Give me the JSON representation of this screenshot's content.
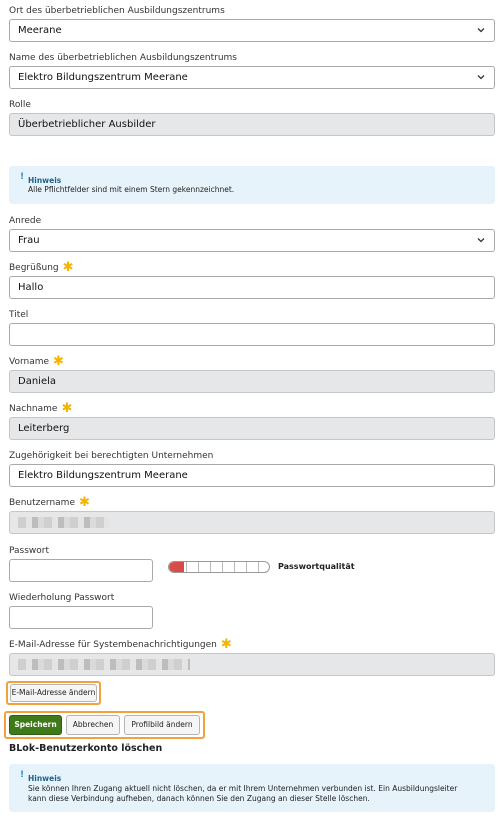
{
  "ort": {
    "label": "Ort des überbetrieblichen Ausbildungszentrums",
    "value": "Meerane"
  },
  "zentrum_name": {
    "label": "Name des überbetrieblichen Ausbildungszentrums",
    "value": "Elektro Bildungszentrum Meerane"
  },
  "rolle": {
    "label": "Rolle",
    "value": "Überbetrieblicher Ausbilder"
  },
  "hint_required": {
    "title": "Hinweis",
    "text": "Alle Pflichtfelder sind mit einem Stern gekennzeichnet.",
    "excl": "!"
  },
  "anrede": {
    "label": "Anrede",
    "value": "Frau"
  },
  "begruessung": {
    "label": "Begrüßung",
    "value": "Hallo"
  },
  "titel": {
    "label": "Titel",
    "value": ""
  },
  "vorname": {
    "label": "Vorname",
    "value": "Daniela"
  },
  "nachname": {
    "label": "Nachname",
    "value": "Leiterberg"
  },
  "zugehoerigkeit": {
    "label": "Zugehörigkeit bei berechtigten Unternehmen",
    "value": "Elektro Bildungszentrum Meerane"
  },
  "benutzername": {
    "label": "Benutzername"
  },
  "passwort": {
    "label": "Passwort",
    "quality_label": "Passwortqualität",
    "quality_fraction": 0.15
  },
  "passwort_wdh": {
    "label": "Wiederholung Passwort"
  },
  "email": {
    "label": "E-Mail-Adresse für Systembenachrichtigungen"
  },
  "buttons": {
    "email_change": "E-Mail-Adresse ändern",
    "save": "Speichern",
    "cancel": "Abbrechen",
    "profile_pic": "Profilbild ändern"
  },
  "delete_section": {
    "title": "BLok-Benutzerkonto löschen"
  },
  "hint_delete": {
    "title": "Hinweis",
    "excl": "!",
    "line1": "Sie können Ihren Zugang aktuell nicht löschen, da er mit Ihrem Unternehmen verbunden ist. Ein Ausbildungsleiter",
    "line2": "kann diese Verbindung aufheben, danach können Sie den Zugang an dieser Stelle löschen."
  },
  "colors": {
    "accent_star": "#f3b400",
    "save_button": "#3f7a1a",
    "highlight": "#f4a13b",
    "hint_bg": "#e7f3fb"
  }
}
